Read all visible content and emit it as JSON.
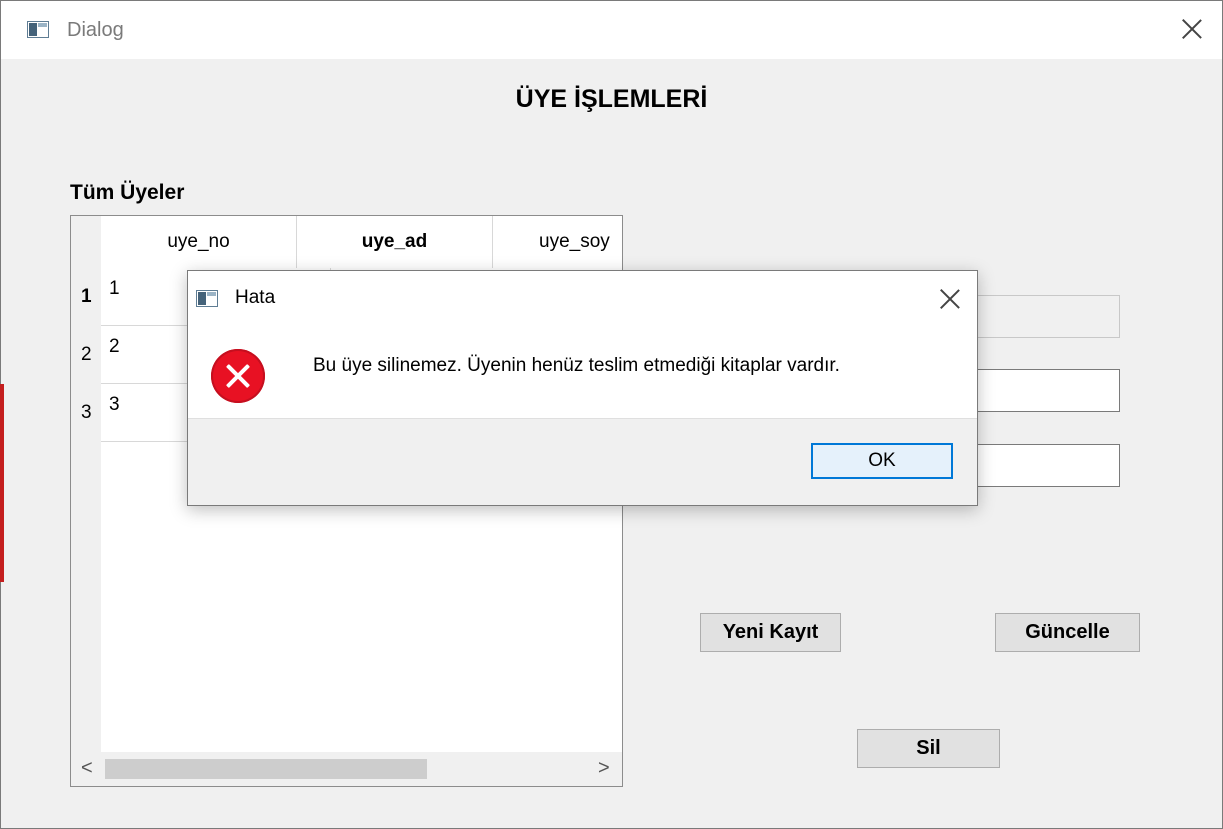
{
  "window": {
    "title": "Dialog"
  },
  "main": {
    "title": "ÜYE İŞLEMLERİ",
    "section_title": "Tüm Üyeler"
  },
  "table": {
    "columns": [
      "uye_no",
      "uye_ad",
      "uye_soy"
    ],
    "rows": [
      {
        "header": "1",
        "uye_no": "1"
      },
      {
        "header": "2",
        "uye_no": "2"
      },
      {
        "header": "3",
        "uye_no": "3"
      }
    ],
    "scroll_left": "<",
    "scroll_right": ">"
  },
  "buttons": {
    "new_record": "Yeni Kayıt",
    "update": "Güncelle",
    "delete": "Sil"
  },
  "error_dialog": {
    "title": "Hata",
    "message": "Bu üye silinemez. Üyenin henüz teslim etmediği kitaplar vardır.",
    "ok_label": "OK"
  },
  "colors": {
    "window_bg": "#f0f0f0",
    "error_icon": "#e81123",
    "focus_border": "#0078d7"
  },
  "icons": [
    "app-icon",
    "close-icon",
    "error-icon"
  ]
}
